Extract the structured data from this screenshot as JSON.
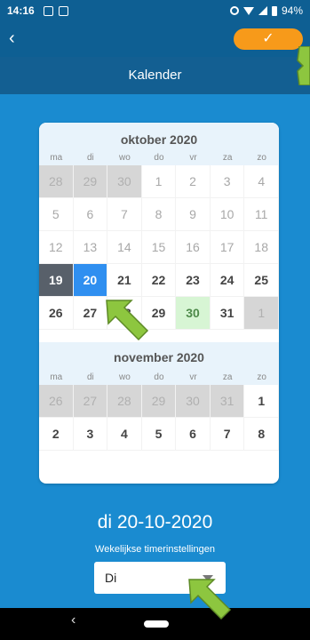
{
  "status": {
    "time": "14:16",
    "battery": "94%"
  },
  "appbar": {
    "back_icon": "‹",
    "confirm_icon": "✓"
  },
  "title": "Kalender",
  "calendar": {
    "weekdays": [
      "ma",
      "di",
      "wo",
      "do",
      "vr",
      "za",
      "zo"
    ],
    "october": {
      "header": "oktober 2020",
      "rows": [
        [
          "28",
          "29",
          "30",
          "1",
          "2",
          "3",
          "4"
        ],
        [
          "5",
          "6",
          "7",
          "8",
          "9",
          "10",
          "11"
        ],
        [
          "12",
          "13",
          "14",
          "15",
          "16",
          "17",
          "18"
        ],
        [
          "19",
          "20",
          "21",
          "22",
          "23",
          "24",
          "25"
        ],
        [
          "26",
          "27",
          "28",
          "29",
          "30",
          "31",
          "1"
        ]
      ]
    },
    "november": {
      "header": "november 2020",
      "rows": [
        [
          "26",
          "27",
          "28",
          "29",
          "30",
          "31",
          "1"
        ],
        [
          "2",
          "3",
          "4",
          "5",
          "6",
          "7",
          "8"
        ]
      ]
    }
  },
  "selected_date": "di 20-10-2020",
  "timer_label": "Wekelijkse timerinstellingen",
  "timer_select_value": "Di",
  "nav": {
    "back_icon": "‹"
  },
  "colors": {
    "accent": "#f79a1a",
    "selected": "#2f8ff0",
    "today": "#58606a",
    "green": "#d7f5d4"
  }
}
